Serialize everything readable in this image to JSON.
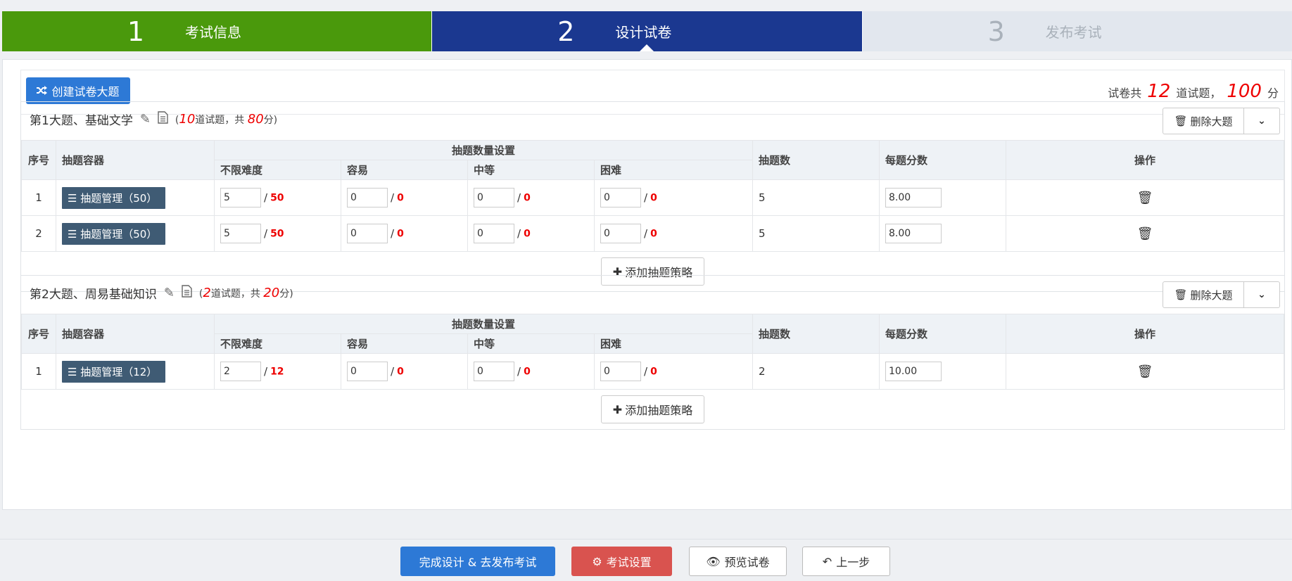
{
  "steps": [
    {
      "num": "1",
      "label": "考试信息"
    },
    {
      "num": "2",
      "label": "设计试卷"
    },
    {
      "num": "3",
      "label": "发布考试"
    }
  ],
  "toolbar": {
    "create_label": "创建试卷大题",
    "summary_prefix": "试卷共",
    "total_questions": "12",
    "summary_mid": "道试题，",
    "total_score": "100",
    "summary_suffix": "分"
  },
  "headers": {
    "index": "序号",
    "container": "抽题容器",
    "qty_setting": "抽题数量设置",
    "any": "不限难度",
    "easy": "容易",
    "medium": "中等",
    "hard": "困难",
    "count": "抽题数",
    "score_each": "每题分数",
    "ops": "操作"
  },
  "sections": [
    {
      "title": "第1大题、基础文学",
      "count_open": "(",
      "questions": "10",
      "q_suffix": "道试题，共",
      "score": "80",
      "score_suffix": "分)",
      "delete_label": "删除大题",
      "add_label": "添加抽题策略",
      "rows": [
        {
          "index": "1",
          "container": "抽题管理（50）",
          "any": "5",
          "any_max": "50",
          "easy": "0",
          "easy_max": "0",
          "medium": "0",
          "medium_max": "0",
          "hard": "0",
          "hard_max": "0",
          "count": "5",
          "score_each": "8.00"
        },
        {
          "index": "2",
          "container": "抽题管理（50）",
          "any": "5",
          "any_max": "50",
          "easy": "0",
          "easy_max": "0",
          "medium": "0",
          "medium_max": "0",
          "hard": "0",
          "hard_max": "0",
          "count": "5",
          "score_each": "8.00"
        }
      ]
    },
    {
      "title": "第2大题、周易基础知识",
      "count_open": "(",
      "questions": "2",
      "q_suffix": "道试题，共",
      "score": "20",
      "score_suffix": "分)",
      "delete_label": "删除大题",
      "add_label": "添加抽题策略",
      "rows": [
        {
          "index": "1",
          "container": "抽题管理（12）",
          "any": "2",
          "any_max": "12",
          "easy": "0",
          "easy_max": "0",
          "medium": "0",
          "medium_max": "0",
          "hard": "0",
          "hard_max": "0",
          "count": "2",
          "score_each": "10.00"
        }
      ]
    }
  ],
  "footer": {
    "finish_label": "完成设计 & 去发布考试",
    "settings_label": "考试设置",
    "preview_label": "预览试卷",
    "prev_label": "上一步"
  },
  "icons": {
    "create": "shuffle-icon",
    "edit": "pencil-icon",
    "doc": "document-icon",
    "delete": "trash-icon",
    "toggle": "chevron-down-icon",
    "container": "list-icon",
    "add": "plus-icon",
    "settings": "gear-icon",
    "preview": "eye-icon",
    "prev": "undo-arrow-icon"
  },
  "colors": {
    "step_done": "#4a990c",
    "step_active": "#1b3890",
    "step_pending": "#e2e7ee",
    "primary": "#2d79d6",
    "danger": "#d9534f",
    "highlight": "#e00000",
    "tag": "#3f5b74"
  }
}
